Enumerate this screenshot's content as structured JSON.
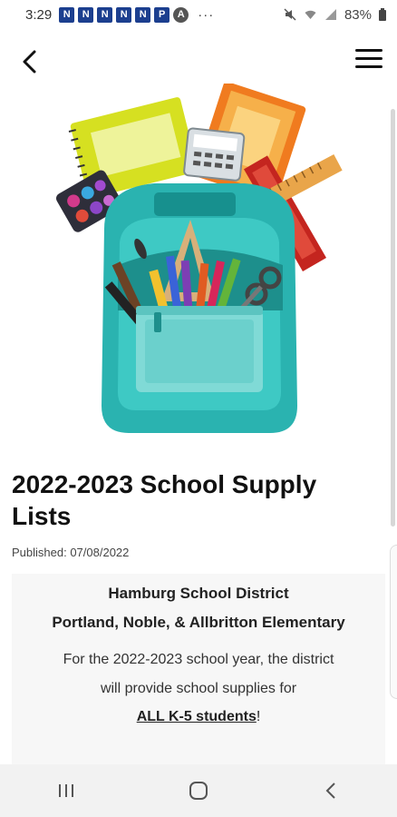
{
  "status_bar": {
    "time": "3:29",
    "notification_letters": [
      "N",
      "N",
      "N",
      "N",
      "N",
      "P",
      "A"
    ],
    "more": "···",
    "battery": "83%"
  },
  "article": {
    "title": "2022-2023 School Supply Lists",
    "published": "Published: 07/08/2022"
  },
  "document": {
    "line1": "Hamburg School District",
    "line2": "Portland, Noble, & Allbritton Elementary",
    "line3": "For the 2022-2023 school year, the district",
    "line4": "will provide school supplies for",
    "line5_underlined": "ALL K-5 students",
    "line5_end": "!"
  },
  "colors": {
    "backpack": "#2ab3b0",
    "backpack_dark": "#17908e",
    "notification_blue": "#1c3f8f"
  },
  "icons": {
    "back": "back-arrow-icon",
    "menu": "hamburger-menu-icon",
    "nav_recents": "recents-icon",
    "nav_home": "home-icon",
    "nav_back": "back-icon"
  }
}
